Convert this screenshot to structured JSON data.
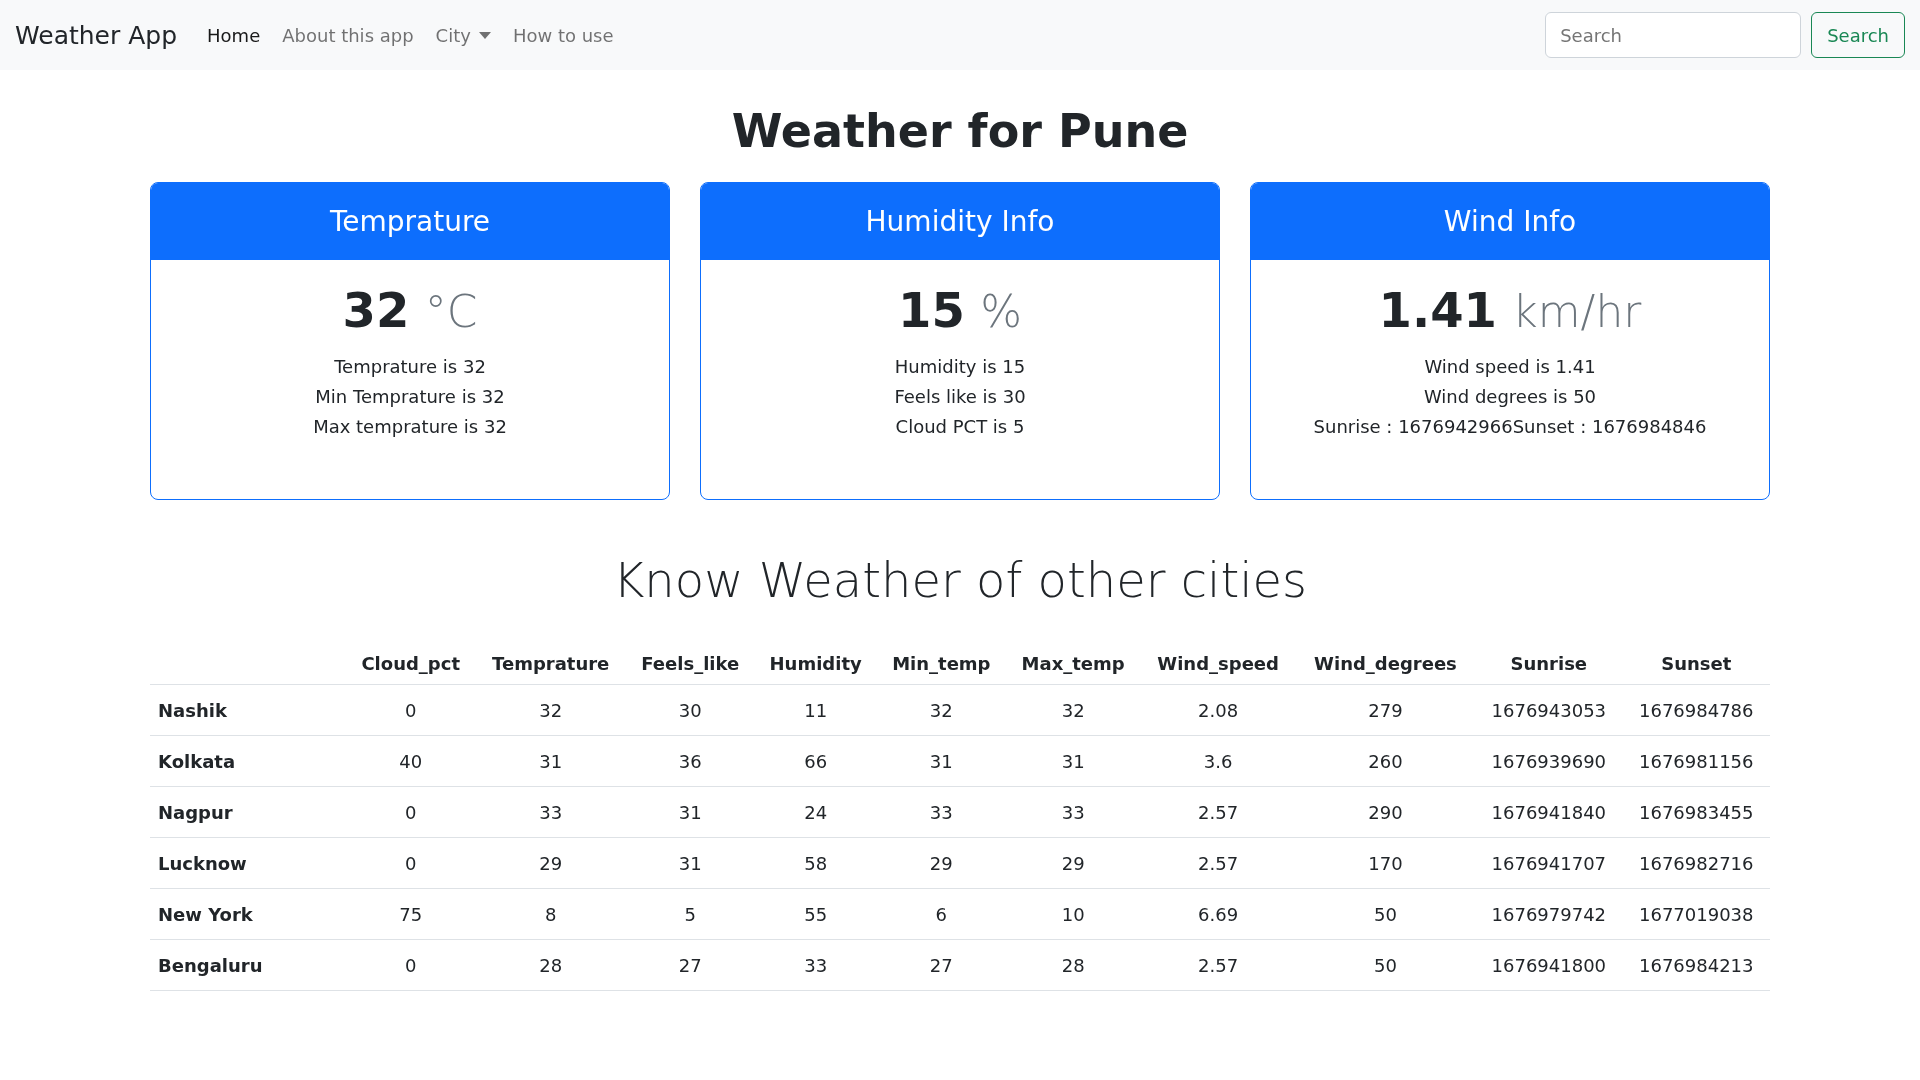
{
  "navbar": {
    "brand": "Weather App",
    "links": [
      {
        "label": "Home",
        "selected": true,
        "kind": "link"
      },
      {
        "label": "About this app",
        "selected": false,
        "kind": "link"
      },
      {
        "label": "City",
        "selected": false,
        "kind": "dropdown"
      },
      {
        "label": "How to use",
        "selected": false,
        "kind": "link"
      }
    ],
    "search": {
      "placeholder": "Search",
      "button": "Search"
    }
  },
  "heading": "Weather for Pune",
  "cards": [
    {
      "title": "Temprature",
      "value": "32",
      "unit": "°C",
      "lines": [
        "Temprature is 32",
        "Min Temprature is 32",
        "Max temprature is 32"
      ]
    },
    {
      "title": "Humidity Info",
      "value": "15",
      "unit": "%",
      "lines": [
        "Humidity is 15",
        "Feels like is 30",
        "Cloud PCT is 5"
      ]
    },
    {
      "title": "Wind Info",
      "value": "1.41",
      "unit": "km/hr",
      "lines": [
        "Wind speed is 1.41",
        "Wind degrees is 50",
        "Sunrise : 1676942966Sunset : 1676984846"
      ]
    }
  ],
  "section_title": "Know Weather of other cities",
  "table": {
    "columns": [
      "Cloud_pct",
      "Temprature",
      "Feels_like",
      "Humidity",
      "Min_temp",
      "Max_temp",
      "Wind_speed",
      "Wind_degrees",
      "Sunrise",
      "Sunset"
    ],
    "rows": [
      {
        "city": "Nashik",
        "cells": [
          "0",
          "32",
          "30",
          "11",
          "32",
          "32",
          "2.08",
          "279",
          "1676943053",
          "1676984786"
        ]
      },
      {
        "city": "Kolkata",
        "cells": [
          "40",
          "31",
          "36",
          "66",
          "31",
          "31",
          "3.6",
          "260",
          "1676939690",
          "1676981156"
        ]
      },
      {
        "city": "Nagpur",
        "cells": [
          "0",
          "33",
          "31",
          "24",
          "33",
          "33",
          "2.57",
          "290",
          "1676941840",
          "1676983455"
        ]
      },
      {
        "city": "Lucknow",
        "cells": [
          "0",
          "29",
          "31",
          "58",
          "29",
          "29",
          "2.57",
          "170",
          "1676941707",
          "1676982716"
        ]
      },
      {
        "city": "New York",
        "cells": [
          "75",
          "8",
          "5",
          "55",
          "6",
          "10",
          "6.69",
          "50",
          "1676979742",
          "1677019038"
        ]
      },
      {
        "city": "Bengaluru",
        "cells": [
          "0",
          "28",
          "27",
          "33",
          "27",
          "28",
          "2.57",
          "50",
          "1676941800",
          "1676984213"
        ]
      }
    ]
  }
}
